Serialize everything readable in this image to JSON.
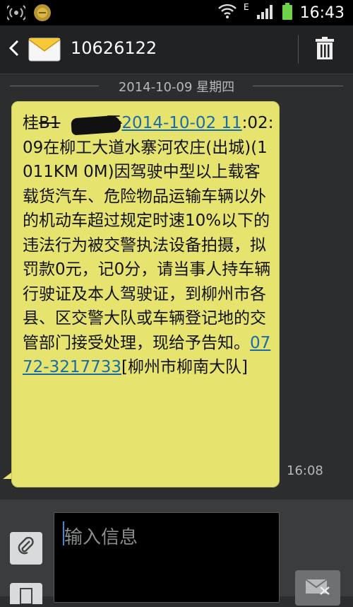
{
  "status_bar": {
    "time": "16:43",
    "network_type": "E",
    "icons": [
      "wireless-broadcast-icon",
      "app-notification-icon",
      "wifi-icon",
      "signal-icon",
      "battery-icon"
    ]
  },
  "header": {
    "contact_number": "10626122",
    "icons": [
      "back-arrow-icon",
      "envelope-icon",
      "trash-icon"
    ]
  },
  "conversation": {
    "date": "2014-10-09 星期四",
    "message": {
      "prefix": "桂",
      "redacted": "B1",
      "redacted_hidden": "于",
      "link_datetime": "2014-10-02 11",
      "time_rest": ":02:09在柳工大道水寨河农庄(出城)(1011KM 0M)因驾驶中型以上载客载货汽车、危险物品运输车辆以外的机动车超过规定时速10%以下的违法行为被交警执法设备拍摄，拟罚款0元，记0分，请当事人持车辆行驶证及本人驾驶证，到柳州市各县、区交警大队或车辆登记地的交管部门接受处理，现给予告知。",
      "link_phone": "0772-3217733",
      "suffix": "[柳州市柳南大队]",
      "time": "16:08"
    }
  },
  "composer": {
    "placeholder": "输入信息"
  },
  "colors": {
    "bubble": "#e7e36f",
    "link": "#1a6ca8",
    "background": "#2b2d2f",
    "status_bar": "#000000"
  }
}
